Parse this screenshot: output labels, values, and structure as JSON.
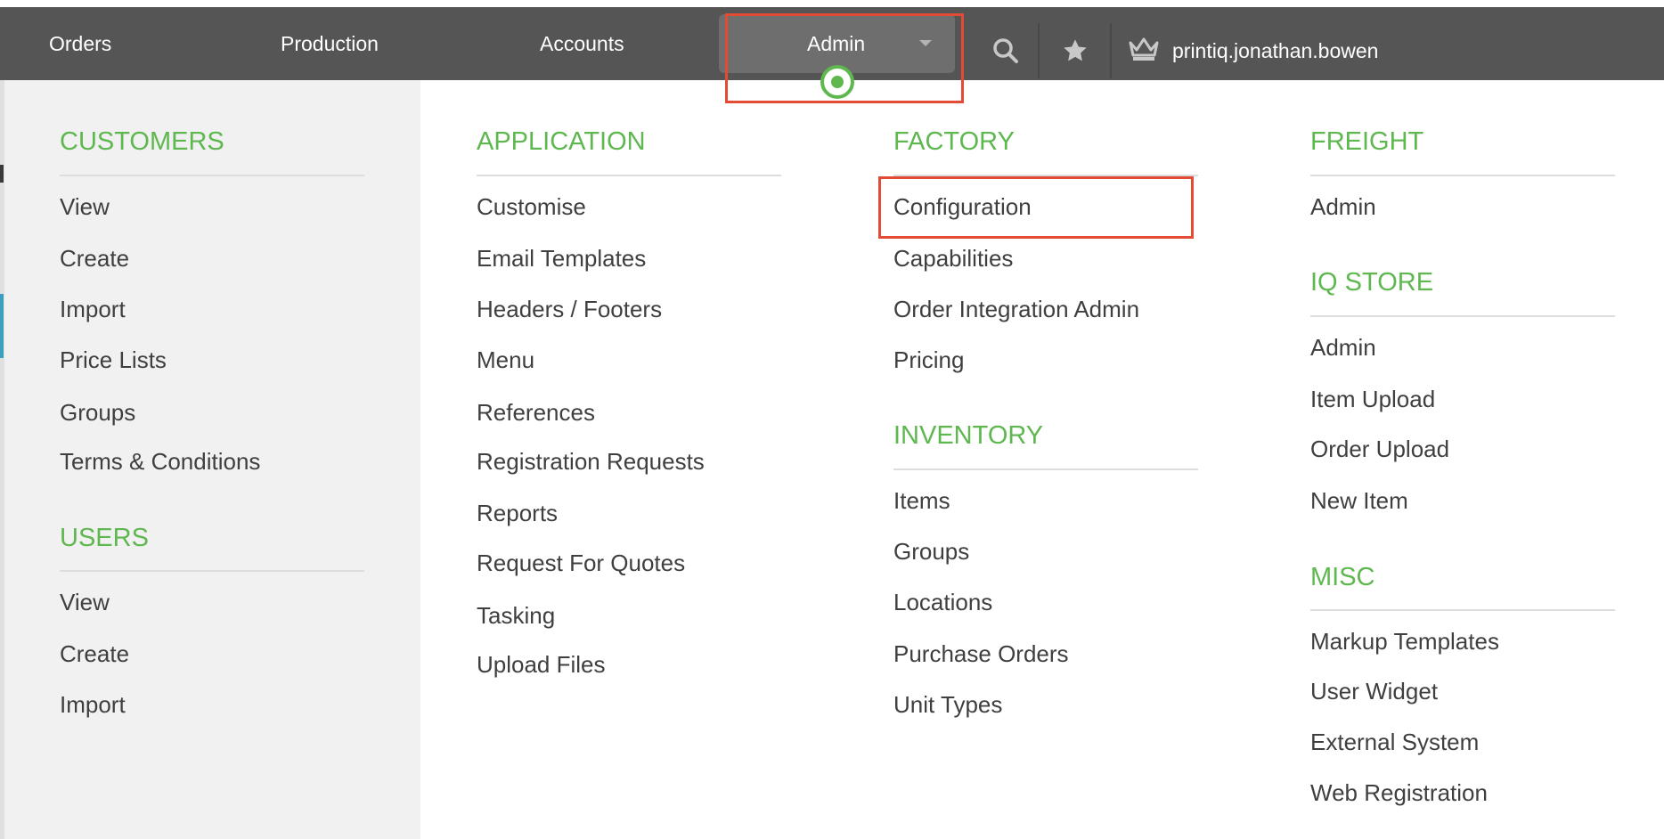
{
  "navbar": {
    "items": [
      "Orders",
      "Production",
      "Accounts"
    ],
    "admin_label": "Admin",
    "search_icon": "search-icon",
    "star_icon": "star-icon",
    "crown_icon": "crown-icon",
    "username": "printiq.jonathan.bowen"
  },
  "colors": {
    "navbar_bg": "#555555",
    "accent_green": "#5eb84f",
    "highlight_red": "#e24b36",
    "left_panel_bg": "#f1f1f1"
  },
  "menu": {
    "customers": {
      "title": "CUSTOMERS",
      "items": [
        "View",
        "Create",
        "Import",
        "Price Lists",
        "Groups",
        "Terms & Conditions"
      ]
    },
    "users": {
      "title": "USERS",
      "items": [
        "View",
        "Create",
        "Import"
      ]
    },
    "application": {
      "title": "APPLICATION",
      "items": [
        "Customise",
        "Email Templates",
        "Headers / Footers",
        "Menu",
        "References",
        "Registration Requests",
        "Reports",
        "Request For Quotes",
        "Tasking",
        "Upload Files"
      ]
    },
    "factory": {
      "title": "FACTORY",
      "items": [
        "Configuration",
        "Capabilities",
        "Order Integration Admin",
        "Pricing"
      ]
    },
    "inventory": {
      "title": "INVENTORY",
      "items": [
        "Items",
        "Groups",
        "Locations",
        "Purchase Orders",
        "Unit Types"
      ]
    },
    "freight": {
      "title": "FREIGHT",
      "items": [
        "Admin"
      ]
    },
    "iq_store": {
      "title": "IQ STORE",
      "items": [
        "Admin",
        "Item Upload",
        "Order Upload",
        "New Item"
      ]
    },
    "misc": {
      "title": "MISC",
      "items": [
        "Markup Templates",
        "User Widget",
        "External System",
        "Web Registration"
      ]
    }
  }
}
